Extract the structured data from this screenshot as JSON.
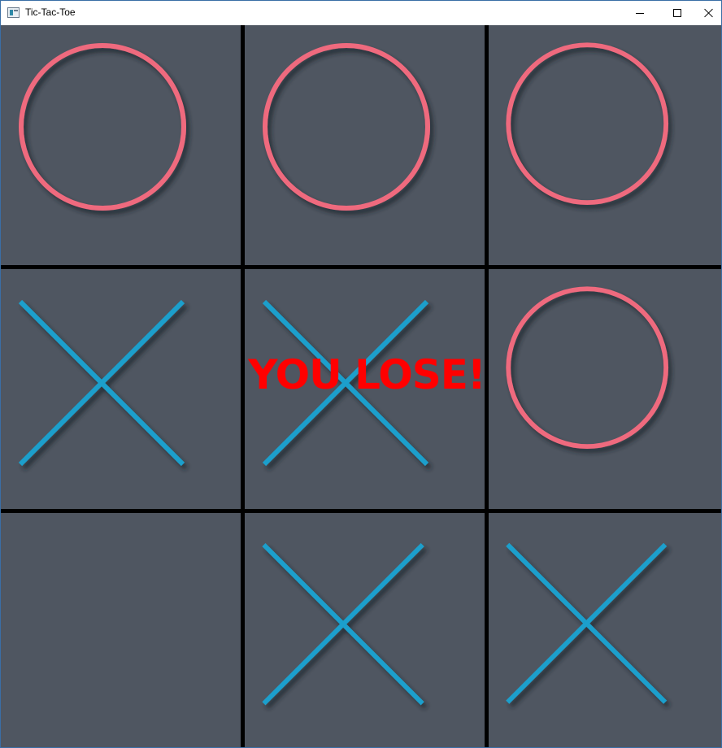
{
  "window": {
    "title": "Tic-Tac-Toe"
  },
  "board": {
    "cells": [
      "O",
      "O",
      "O",
      "X",
      "X",
      "O",
      "",
      "X",
      "X"
    ]
  },
  "result_text": "YOU LOSE!",
  "colors": {
    "o_mark": "#ef6a7e",
    "x_mark": "#1a9fcc",
    "cell_bg": "#4f5661",
    "grid_line": "#000000",
    "result_text": "#ff0000"
  }
}
